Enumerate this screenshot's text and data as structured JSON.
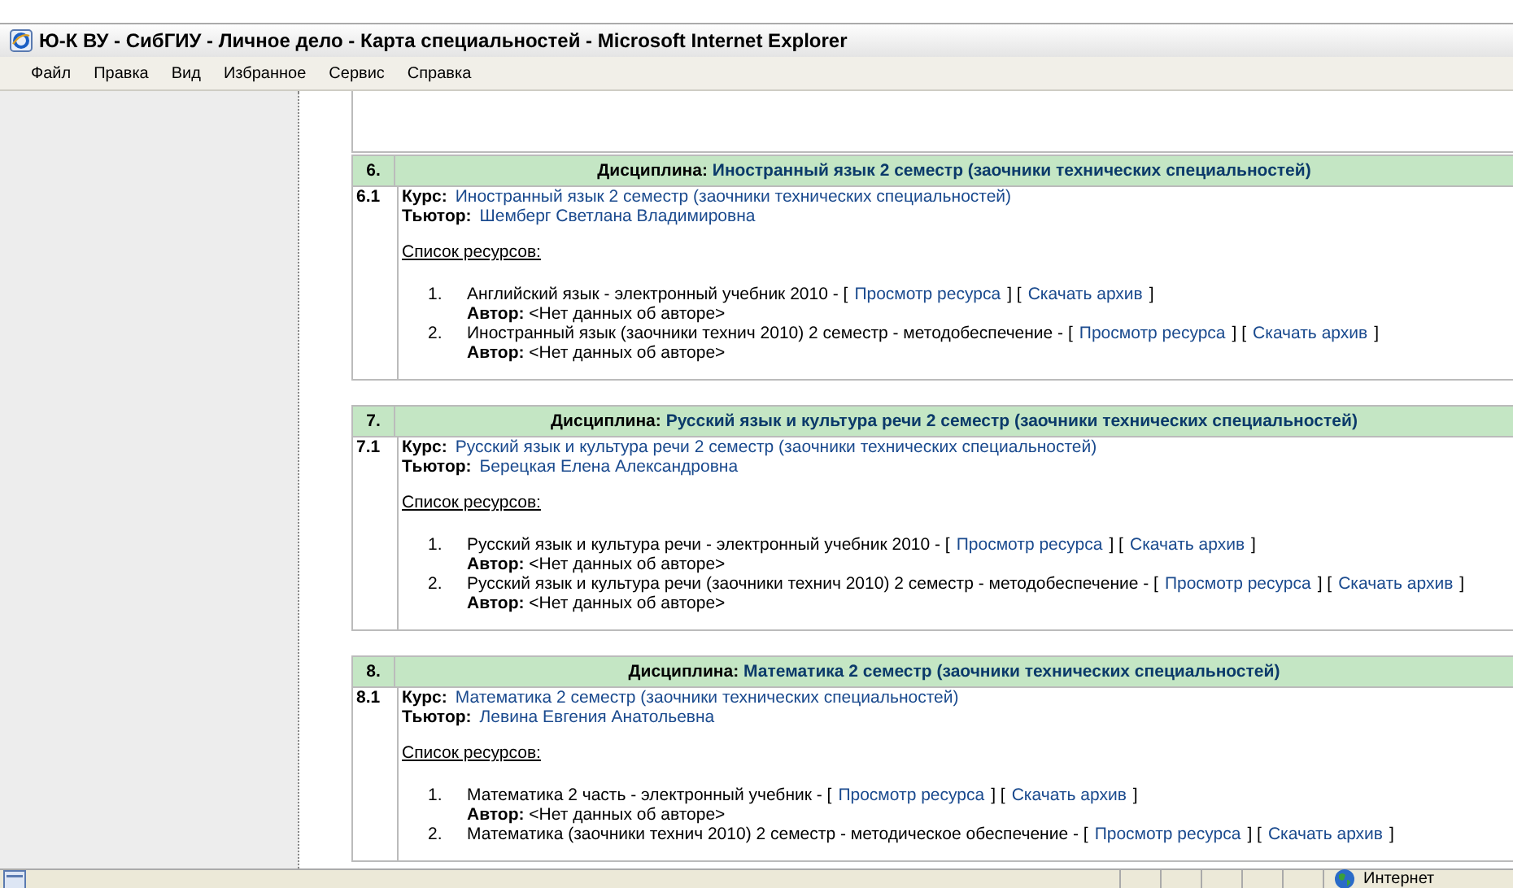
{
  "window": {
    "title": "Ю-К ВУ - СибГИУ - Личное дело - Карта специальностей - Microsoft Internet Explorer"
  },
  "menu": [
    "Файл",
    "Правка",
    "Вид",
    "Избранное",
    "Сервис",
    "Справка"
  ],
  "sections": [
    {
      "number": "6.",
      "discipline_label": "Дисциплина:",
      "discipline": "Иностранный язык 2 семестр (заочники технических специальностей)",
      "course_number": "6.1",
      "course_label": "Курс:",
      "course": "Иностранный язык 2 семестр (заочники технических специальностей)",
      "tutor_label": "Тьютор:",
      "tutor": "Шемберг Светлана Владимировна",
      "resources_label": "Список ресурсов:",
      "resources": [
        {
          "number": "1.",
          "parts": [
            {
              "kind": "text",
              "text": "Английский язык - электронный учебник 2010 - ["
            },
            {
              "kind": "link",
              "text": "Просмотр ресурса"
            },
            {
              "kind": "text",
              "text": "]   ["
            },
            {
              "kind": "link",
              "text": "Скачать архив"
            },
            {
              "kind": "text",
              "text": "]"
            }
          ],
          "author_label": "Автор:",
          "author": "<Нет данных об авторе>"
        },
        {
          "number": "2.",
          "parts": [
            {
              "kind": "text",
              "text": "Иностранный язык (заочники технич 2010) 2 семестр - методобеспечение - ["
            },
            {
              "kind": "link",
              "text": "Просмотр ресурса"
            },
            {
              "kind": "text",
              "text": "]   ["
            },
            {
              "kind": "link",
              "text": "Скачать архив"
            },
            {
              "kind": "text",
              "text": "]"
            }
          ],
          "author_label": "Автор:",
          "author": "<Нет данных об авторе>"
        }
      ]
    },
    {
      "number": "7.",
      "discipline_label": "Дисциплина:",
      "discipline": "Русский язык и культура речи 2 семестр (заочники технических специальностей)",
      "course_number": "7.1",
      "course_label": "Курс:",
      "course": "Русский язык и культура речи 2 семестр (заочники технических специальностей)",
      "tutor_label": "Тьютор:",
      "tutor": "Берецкая Елена Александровна",
      "resources_label": "Список ресурсов:",
      "resources": [
        {
          "number": "1.",
          "parts": [
            {
              "kind": "text",
              "text": "Русский язык и культура речи - электронный учебник 2010 - ["
            },
            {
              "kind": "link",
              "text": "Просмотр ресурса"
            },
            {
              "kind": "text",
              "text": "]   ["
            },
            {
              "kind": "link",
              "text": "Скачать архив"
            },
            {
              "kind": "text",
              "text": "]"
            }
          ],
          "author_label": "Автор:",
          "author": "<Нет данных об авторе>"
        },
        {
          "number": "2.",
          "parts": [
            {
              "kind": "text",
              "text": "Русский язык и культура речи (заочники технич 2010) 2 семестр - методобеспечение - ["
            },
            {
              "kind": "link",
              "text": "Просмотр ресурса"
            },
            {
              "kind": "text",
              "text": "]   ["
            },
            {
              "kind": "link",
              "text": "Скачать архив"
            },
            {
              "kind": "text",
              "text": "]"
            }
          ],
          "author_label": "Автор:",
          "author": "<Нет данных об авторе>"
        }
      ]
    },
    {
      "number": "8.",
      "discipline_label": "Дисциплина:",
      "discipline": "Математика 2 семестр (заочники технических специальностей)",
      "course_number": "8.1",
      "course_label": "Курс:",
      "course": "Математика 2 семестр (заочники технических специальностей)",
      "tutor_label": "Тьютор:",
      "tutor": "Левина Евгения Анатольевна",
      "resources_label": "Список ресурсов:",
      "resources": [
        {
          "number": "1.",
          "parts": [
            {
              "kind": "text",
              "text": "Математика 2 часть - электронный учебник - ["
            },
            {
              "kind": "link",
              "text": "Просмотр ресурса"
            },
            {
              "kind": "text",
              "text": "]   ["
            },
            {
              "kind": "link",
              "text": "Скачать архив"
            },
            {
              "kind": "text",
              "text": "]"
            }
          ],
          "author_label": "Автор:",
          "author": "<Нет данных об авторе>"
        },
        {
          "number": "2.",
          "parts": [
            {
              "kind": "text",
              "text": "Математика (заочники технич 2010) 2 семестр - методическое обеспечение - ["
            },
            {
              "kind": "link",
              "text": "Просмотр ресурса"
            },
            {
              "kind": "text",
              "text": "]   ["
            },
            {
              "kind": "link",
              "text": "Скачать архив"
            },
            {
              "kind": "text",
              "text": "]"
            }
          ]
        }
      ]
    }
  ],
  "status_bar": {
    "zone": "Интернет"
  }
}
